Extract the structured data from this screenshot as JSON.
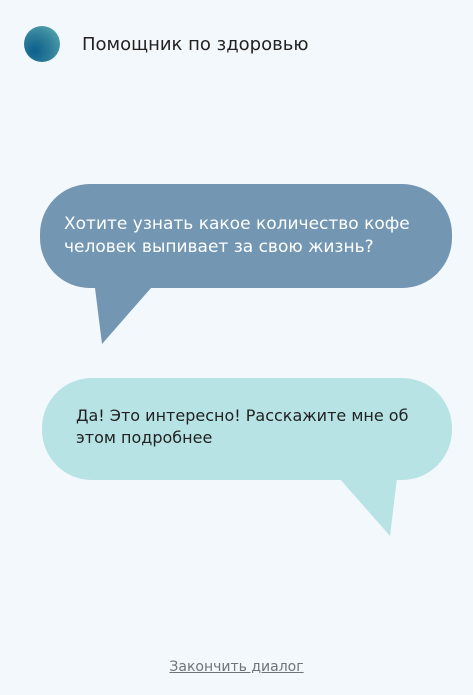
{
  "header": {
    "title": "Помощник по здоровью"
  },
  "messages": [
    {
      "role": "assistant",
      "text": "Хотите узнать какое количество кофе человек выпивает за свою жизнь?"
    },
    {
      "role": "user",
      "text": "Да! Это интересно! Расскажите мне об этом подробнее"
    }
  ],
  "footer": {
    "end_dialog_label": "Закончить диалог"
  },
  "colors": {
    "background": "#f3f8fc",
    "assistant_bubble": "#7397b3",
    "user_bubble": "#b7e3e4",
    "avatar_gradient_dark": "#0c5f8e",
    "avatar_gradient_light": "#5fb1b3",
    "link_text": "#6f7478"
  }
}
